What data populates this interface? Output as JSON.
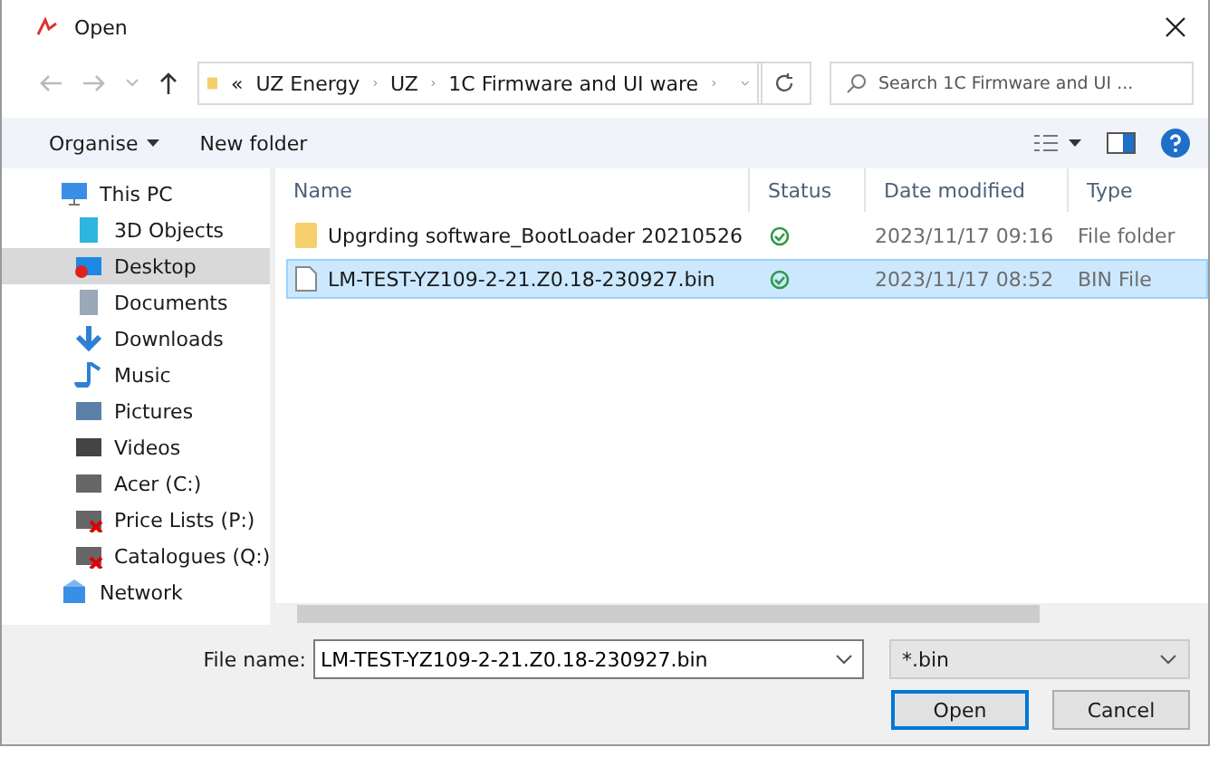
{
  "window": {
    "title": "Open"
  },
  "address": {
    "crumbs": [
      "«",
      "UZ Energy",
      "UZ",
      "1C Firmware and UI ware"
    ]
  },
  "search": {
    "placeholder": "Search 1C Firmware and UI ..."
  },
  "toolbar": {
    "organise": "Organise",
    "new_folder": "New folder"
  },
  "sidebar": {
    "items": [
      {
        "label": "This PC",
        "kind": "pc",
        "selected": false,
        "children": [
          {
            "label": "3D Objects",
            "kind": "cube",
            "selected": false
          },
          {
            "label": "Desktop",
            "kind": "desktop",
            "selected": true
          },
          {
            "label": "Documents",
            "kind": "doc",
            "selected": false
          },
          {
            "label": "Downloads",
            "kind": "download",
            "selected": false
          },
          {
            "label": "Music",
            "kind": "music",
            "selected": false
          },
          {
            "label": "Pictures",
            "kind": "pictures",
            "selected": false
          },
          {
            "label": "Videos",
            "kind": "videos",
            "selected": false
          },
          {
            "label": "Acer (C:)",
            "kind": "drive",
            "selected": false
          },
          {
            "label": "Price Lists (P:)",
            "kind": "netdrive",
            "selected": false
          },
          {
            "label": "Catalogues (Q:)",
            "kind": "netdrive",
            "selected": false
          }
        ]
      },
      {
        "label": "Network",
        "kind": "network",
        "selected": false
      }
    ]
  },
  "table": {
    "columns": [
      "Name",
      "Status",
      "Date modified",
      "Type"
    ],
    "rows": [
      {
        "kind": "folder",
        "name": "Upgrding software_BootLoader 20210526",
        "date": "2023/11/17 09:16",
        "type": "File folder",
        "selected": false
      },
      {
        "kind": "file",
        "name": "LM-TEST-YZ109-2-21.Z0.18-230927.bin",
        "date": "2023/11/17 08:52",
        "type": "BIN File",
        "selected": true
      }
    ]
  },
  "footer": {
    "file_name_label": "File name:",
    "file_name": "LM-TEST-YZ109-2-21.Z0.18-230927.bin",
    "filter": "*.bin",
    "buttons": [
      "Open",
      "Cancel"
    ]
  }
}
